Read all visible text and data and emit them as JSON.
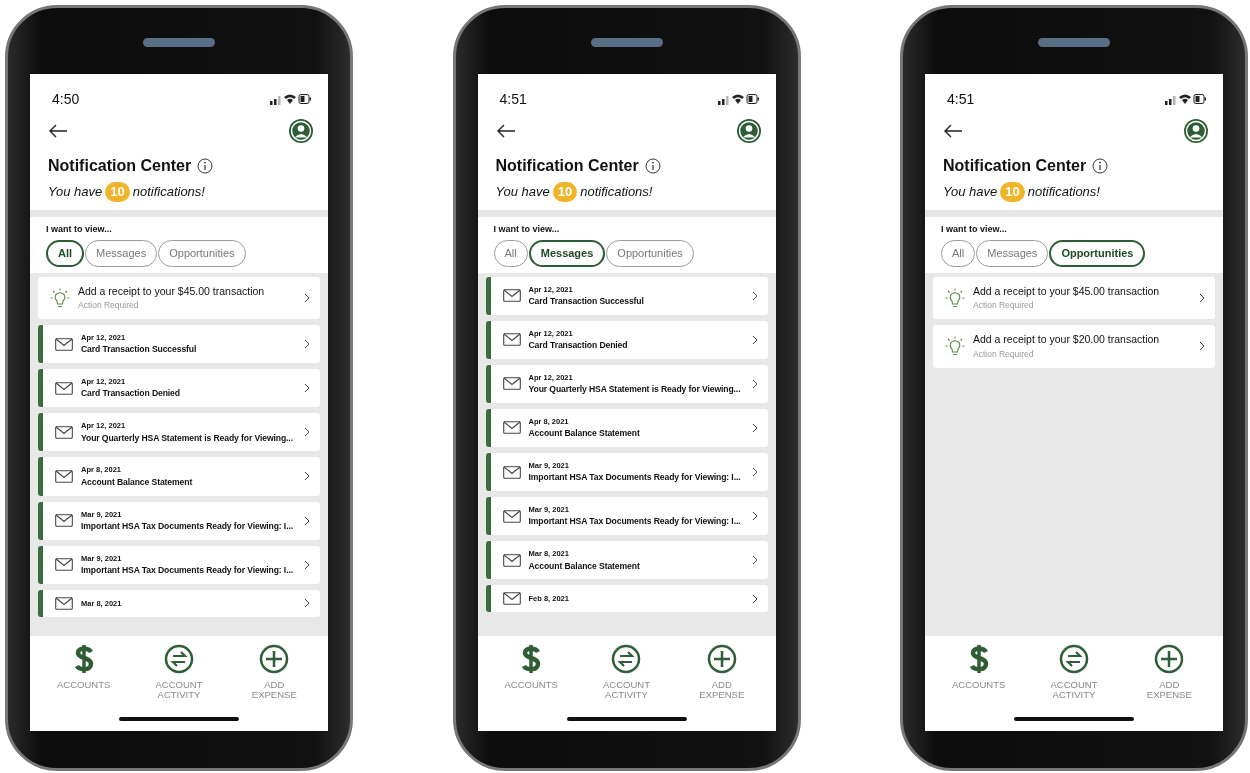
{
  "phones": [
    {
      "time": "4:50",
      "title": "Notification Center",
      "count_before": "You have",
      "count": "10",
      "count_after": "notifications!",
      "filter_label": "I want to view...",
      "filters": [
        {
          "label": "All",
          "selected": true
        },
        {
          "label": "Messages",
          "selected": false
        },
        {
          "label": "Opportunities",
          "selected": false
        }
      ],
      "notifications": [
        {
          "kind": "opportunity",
          "title": "Add a receipt to your $45.00 transaction",
          "subtitle": "Action Required"
        },
        {
          "kind": "message",
          "date": "Apr 12, 2021",
          "title": "Card Transaction Successful"
        },
        {
          "kind": "message",
          "date": "Apr 12, 2021",
          "title": "Card Transaction Denied"
        },
        {
          "kind": "message",
          "date": "Apr 12, 2021",
          "title": "Your Quarterly HSA Statement is Ready for Viewing..."
        },
        {
          "kind": "message",
          "date": "Apr 8, 2021",
          "title": "Account Balance Statement"
        },
        {
          "kind": "message",
          "date": "Mar 9, 2021",
          "title": "Important HSA Tax Documents Ready for Viewing: I..."
        },
        {
          "kind": "message",
          "date": "Mar 9, 2021",
          "title": "Important HSA Tax Documents Ready for Viewing: I..."
        },
        {
          "kind": "message",
          "date": "Mar 8, 2021"
        }
      ],
      "nav": [
        {
          "kind": "dollar",
          "label": "ACCOUNTS"
        },
        {
          "kind": "exchange",
          "label": "ACCOUNT ACTIVITY"
        },
        {
          "kind": "plus",
          "label": "ADD EXPENSE"
        }
      ]
    },
    {
      "time": "4:51",
      "title": "Notification Center",
      "count_before": "You have",
      "count": "10",
      "count_after": "notifications!",
      "filter_label": "I want to view...",
      "filters": [
        {
          "label": "All",
          "selected": false
        },
        {
          "label": "Messages",
          "selected": true
        },
        {
          "label": "Opportunities",
          "selected": false
        }
      ],
      "notifications": [
        {
          "kind": "message",
          "date": "Apr 12, 2021",
          "title": "Card Transaction Successful"
        },
        {
          "kind": "message",
          "date": "Apr 12, 2021",
          "title": "Card Transaction Denied"
        },
        {
          "kind": "message",
          "date": "Apr 12, 2021",
          "title": "Your Quarterly HSA Statement is Ready for Viewing..."
        },
        {
          "kind": "message",
          "date": "Apr 8, 2021",
          "title": "Account Balance Statement"
        },
        {
          "kind": "message",
          "date": "Mar 9, 2021",
          "title": "Important HSA Tax Documents Ready for Viewing: I..."
        },
        {
          "kind": "message",
          "date": "Mar 9, 2021",
          "title": "Important HSA Tax Documents Ready for Viewing: I..."
        },
        {
          "kind": "message",
          "date": "Mar 8, 2021",
          "title": "Account Balance Statement"
        },
        {
          "kind": "message",
          "date": "Feb 8, 2021"
        }
      ],
      "nav": [
        {
          "kind": "dollar",
          "label": "ACCOUNTS"
        },
        {
          "kind": "exchange",
          "label": "ACCOUNT ACTIVITY"
        },
        {
          "kind": "plus",
          "label": "ADD EXPENSE"
        }
      ]
    },
    {
      "time": "4:51",
      "title": "Notification Center",
      "count_before": "You have",
      "count": "10",
      "count_after": "notifications!",
      "filter_label": "I want to view...",
      "filters": [
        {
          "label": "All",
          "selected": false
        },
        {
          "label": "Messages",
          "selected": false
        },
        {
          "label": "Opportunities",
          "selected": true
        }
      ],
      "notifications": [
        {
          "kind": "opportunity",
          "title": "Add a receipt to your $45.00 transaction",
          "subtitle": "Action Required"
        },
        {
          "kind": "opportunity",
          "title": "Add a receipt to your $20.00 transaction",
          "subtitle": "Action Required"
        }
      ],
      "nav": [
        {
          "kind": "dollar",
          "label": "ACCOUNTS"
        },
        {
          "kind": "exchange",
          "label": "ACCOUNT ACTIVITY"
        },
        {
          "kind": "plus",
          "label": "ADD EXPENSE"
        }
      ]
    }
  ]
}
